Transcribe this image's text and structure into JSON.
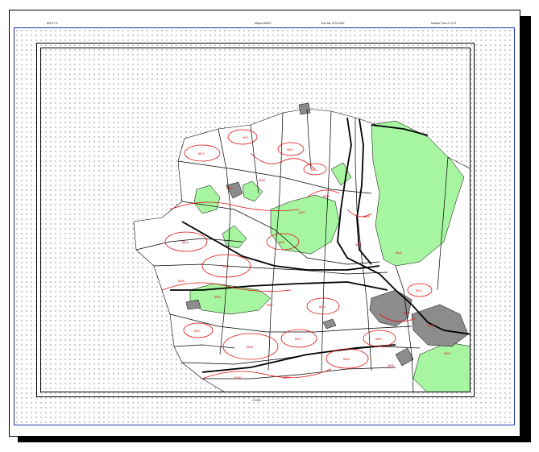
{
  "header": {
    "left": "BM 07 9",
    "center": "Mapa 4/EM3",
    "mid_right": "Trať kat. 4/78 3/40",
    "right": "Katastr: Nov-3 1/73"
  },
  "footer": {
    "scale": "1:5000"
  },
  "colors": {
    "forest_fill": "#a6f5a0",
    "built_fill": "#8c8c8c",
    "contour_red": "#e01010",
    "parcel_line": "#000000",
    "frame_blue": "#2233aa"
  },
  "map": {
    "labels": [
      "8611",
      "8612",
      "8613",
      "8614",
      "8615",
      "8616",
      "8617",
      "8618",
      "8619",
      "8620",
      "8621",
      "8622",
      "8623",
      "8624",
      "8625",
      "8626",
      "8627",
      "8628",
      "8629",
      "8630",
      "8631",
      "8632",
      "8633",
      "8634",
      "8635",
      "8636",
      "8637",
      "8638",
      "8639",
      "8640"
    ]
  }
}
